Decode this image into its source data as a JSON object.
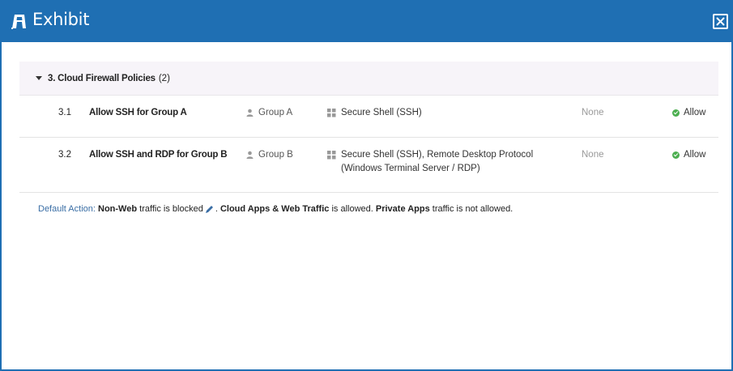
{
  "window": {
    "title": "Exhibit"
  },
  "icons": {
    "title": "exhibit-logo-icon",
    "close": "close-icon",
    "group": "user-icon",
    "app": "app-grid-icon",
    "allow": "check-circle-icon",
    "edit": "pencil-icon"
  },
  "colors": {
    "titlebar": "#1f6fb3",
    "allow": "#4caf50",
    "section_bg": "#f7f4f9",
    "label_blue": "#3a6ea5"
  },
  "section": {
    "title": "3. Cloud Firewall Policies",
    "count": "(2)"
  },
  "policies": [
    {
      "number": "3.1",
      "name": "Allow SSH for Group A",
      "group": "Group A",
      "apps_line1": "Secure Shell (SSH)",
      "apps_line2": "",
      "exception": "None",
      "action": "Allow"
    },
    {
      "number": "3.2",
      "name": "Allow SSH and RDP for Group B",
      "group": "Group B",
      "apps_line1": "Secure Shell (SSH), Remote Desktop Protocol",
      "apps_line2": "(Windows Terminal Server / RDP)",
      "exception": "None",
      "action": "Allow"
    }
  ],
  "default_action": {
    "label": "Default Action:",
    "non_web": "Non-Web",
    "non_web_text": "traffic is blocked",
    "cloud_apps": "Cloud Apps & Web Traffic",
    "cloud_apps_text": "is allowed.",
    "private_apps": "Private Apps",
    "private_apps_text": "traffic is not allowed."
  }
}
